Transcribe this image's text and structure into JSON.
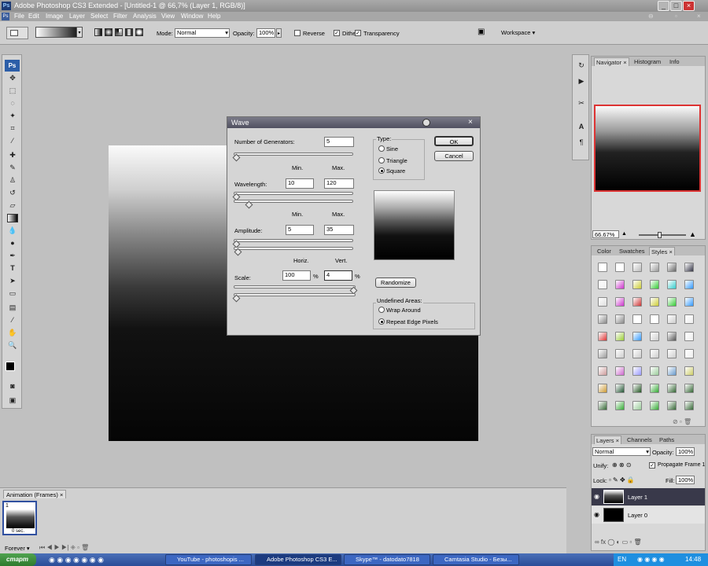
{
  "app": {
    "title": "Adobe Photoshop CS3 Extended - [Untitled-1 @ 66,7% (Layer 1, RGB/8)]",
    "logo": "Ps"
  },
  "menu": [
    "File",
    "Edit",
    "Image",
    "Layer",
    "Select",
    "Filter",
    "Analysis",
    "View",
    "Window",
    "Help"
  ],
  "options": {
    "mode_label": "Mode:",
    "mode_value": "Normal",
    "opacity_label": "Opacity:",
    "opacity_value": "100%",
    "reverse_label": "Reverse",
    "reverse_checked": false,
    "dither_label": "Dither",
    "dither_checked": true,
    "transparency_label": "Transparency",
    "transparency_checked": true,
    "workspace_label": "Workspace"
  },
  "wave": {
    "title": "Wave",
    "generators_label": "Number of Generators:",
    "generators_value": "5",
    "min_label": "Min.",
    "max_label": "Max.",
    "wavelength_label": "Wavelength:",
    "wavelength_min": "10",
    "wavelength_max": "120",
    "amplitude_label": "Amplitude:",
    "amplitude_min": "5",
    "amplitude_max": "35",
    "horiz_label": "Horiz.",
    "vert_label": "Vert.",
    "scale_label": "Scale:",
    "scale_horiz": "100",
    "scale_vert": "4",
    "percent": "%",
    "type_label": "Type:",
    "type_options": [
      "Sine",
      "Triangle",
      "Square"
    ],
    "type_selected": "Square",
    "ok_label": "OK",
    "cancel_label": "Cancel",
    "randomize_label": "Randomize",
    "undefined_label": "Undefined Areas:",
    "undefined_options": [
      "Wrap Around",
      "Repeat Edge Pixels"
    ],
    "undefined_selected": "Repeat Edge Pixels"
  },
  "navigator": {
    "tabs": [
      "Navigator",
      "Histogram",
      "Info"
    ],
    "zoom": "66.67%"
  },
  "styles_panel": {
    "tabs": [
      "Color",
      "Swatches",
      "Styles"
    ]
  },
  "layers_panel": {
    "tabs": [
      "Layers",
      "Channels",
      "Paths"
    ],
    "blend_mode": "Normal",
    "opacity_label": "Opacity:",
    "opacity_value": "100%",
    "unify_label": "Unify:",
    "propagate_label": "Propagate Frame 1",
    "lock_label": "Lock:",
    "fill_label": "Fill:",
    "fill_value": "100%",
    "layers": [
      {
        "name": "Layer 1",
        "selected": true
      },
      {
        "name": "Layer 0",
        "selected": false
      }
    ]
  },
  "animation": {
    "tab": "Animation (Frames)",
    "frame_number": "1",
    "frame_delay": "0 sec.",
    "loop": "Forever"
  },
  "taskbar": {
    "start": "старт",
    "tasks": [
      "YouTube - photoshopis ...",
      "Adobe Photoshop CS3 E...",
      "Skype™ - datodato7818",
      "Camtasia Studio - Безы..."
    ],
    "active_task": 1,
    "lang": "EN",
    "clock": "14:48"
  }
}
